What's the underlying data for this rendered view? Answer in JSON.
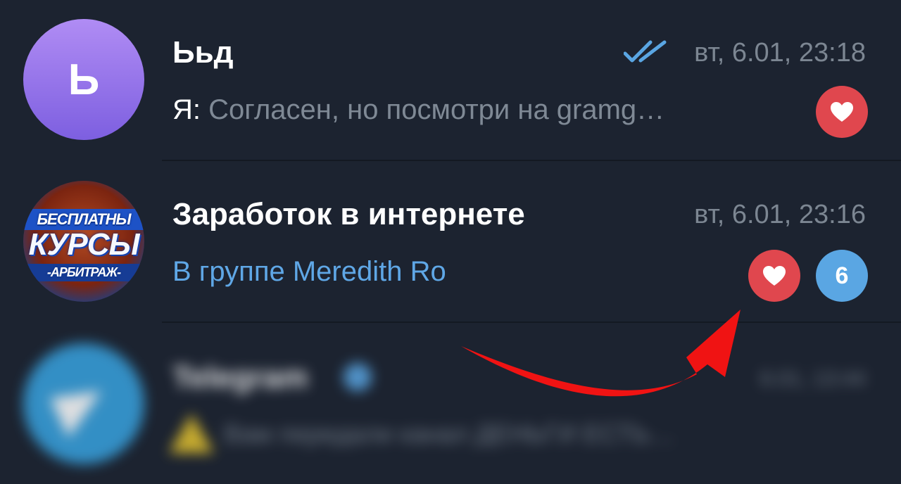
{
  "chats": [
    {
      "avatar_letter": "Ь",
      "title": "Ььд",
      "time": "вт, 6.01, 23:18",
      "status_icon": "double-check-icon",
      "preview_sender": "Я:",
      "preview_text": " Согласен, но посмотри на gramg…",
      "reaction_icon": "heart-icon"
    },
    {
      "avatar_lines": [
        "БЕСПЛАТНЫ",
        "КУРСЫ",
        "-АРБИТРАЖ-"
      ],
      "title": "Заработок в интернете",
      "time": "вт, 6.01, 23:16",
      "preview_text": "В группе Meredith Ro",
      "reaction_icon": "heart-icon",
      "unread_count": "6"
    },
    {
      "avatar_icon": "telegram-plane-icon",
      "title": "Telegram",
      "time": "6.01, 13:44",
      "preview_text": "Вам передали канал ДЕНЬГИ ЕСТЬ…",
      "verified_icon": "verified-icon",
      "warning_icon": "warning-icon"
    }
  ],
  "colors": {
    "background": "#1c2330",
    "accent": "#5aa6e3",
    "reaction": "#e0474e",
    "annotation_arrow": "#f01313"
  }
}
